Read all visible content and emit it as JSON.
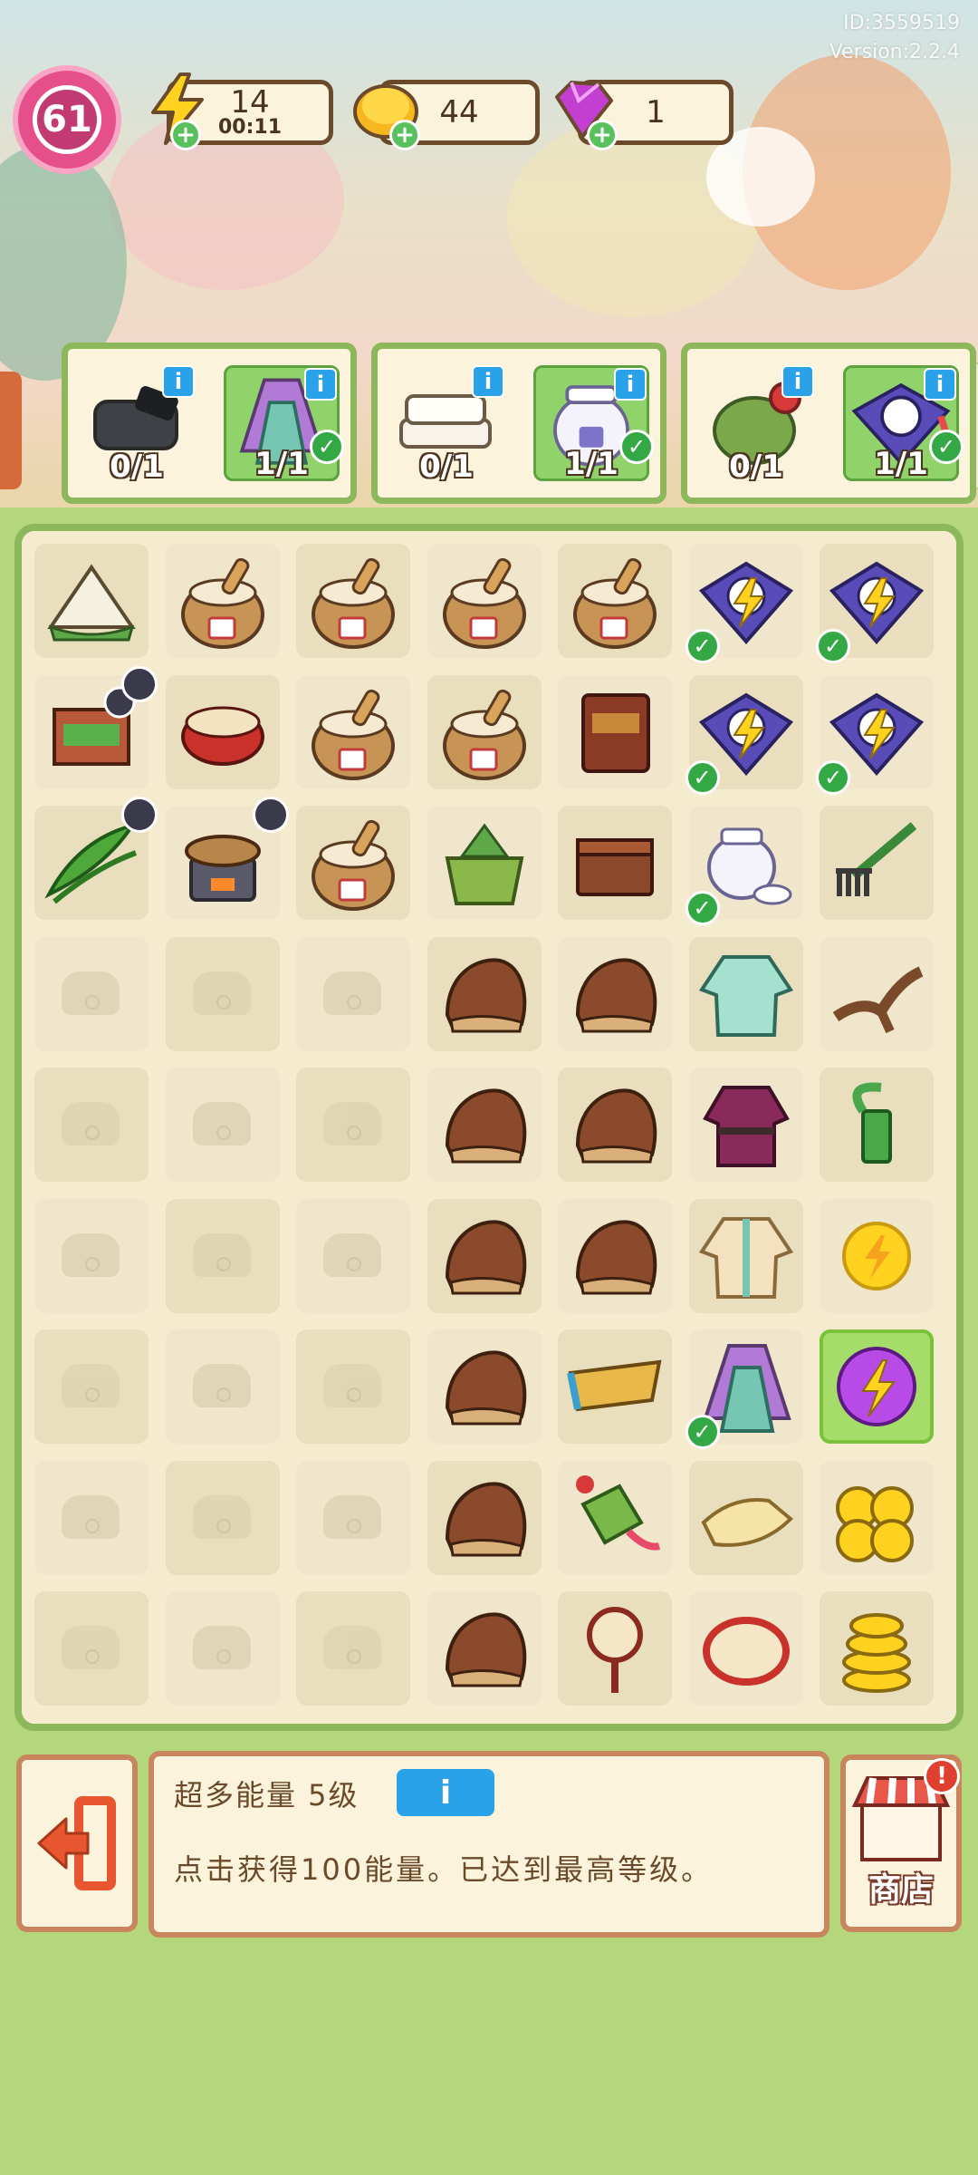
{
  "meta": {
    "id_text": "ID:3559519",
    "version_text": "Version:2.2.4"
  },
  "player": {
    "level": "61"
  },
  "resources": {
    "energy": {
      "value": "14",
      "timer": "00:11"
    },
    "coins": {
      "value": "44"
    },
    "gems": {
      "value": "1"
    }
  },
  "orders": [
    {
      "items": [
        {
          "name": "ink-stone",
          "count": "0/1",
          "done": false
        },
        {
          "name": "hanfu-dress",
          "count": "1/1",
          "done": true
        }
      ]
    },
    {
      "items": [
        {
          "name": "folded-cloth",
          "count": "0/1",
          "done": false
        },
        {
          "name": "cream-jar",
          "count": "1/1",
          "done": true
        }
      ]
    },
    {
      "items": [
        {
          "name": "pouch",
          "count": "0/1",
          "done": false
        },
        {
          "name": "bird-kite",
          "count": "1/1",
          "done": true
        }
      ]
    }
  ],
  "board": {
    "rows": [
      [
        "zongzi-duck",
        "rice-sack",
        "rice-sack",
        "rice-sack",
        "rice-sack",
        "bird-kite-energy",
        "bird-kite-energy"
      ],
      [
        "market-stall",
        "drum",
        "rice-sack",
        "rice-sack",
        "cabinet",
        "bird-kite-energy",
        "bird-kite-energy"
      ],
      [
        "bamboo-leaves",
        "stove",
        "rice-sack",
        "zongzi-basket",
        "box",
        "cream-jar",
        "rake"
      ],
      [
        "locked",
        "locked",
        "locked",
        "chestnut",
        "chestnut",
        "green-robe",
        "twig"
      ],
      [
        "locked",
        "locked",
        "locked",
        "chestnut",
        "chestnut",
        "purple-robe",
        "pump"
      ],
      [
        "locked",
        "locked",
        "locked",
        "chestnut",
        "chestnut",
        "beige-robe",
        "energy-coin"
      ],
      [
        "locked",
        "locked",
        "locked",
        "chestnut",
        "boat-tray",
        "hanfu-dress",
        "energy-orb"
      ],
      [
        "locked",
        "locked",
        "locked",
        "chestnut",
        "kite-bag",
        "silk-cloth",
        "coin-pile"
      ],
      [
        "locked",
        "locked",
        "locked",
        "chestnut",
        "rattle-drum",
        "tambourine",
        "coin-stack"
      ]
    ],
    "checked": [
      "0-5",
      "0-6",
      "1-5",
      "1-6",
      "2-5",
      "6-5"
    ]
  },
  "panel": {
    "title": "超多能量 5级",
    "info_label": "i",
    "description": "点击获得100能量。已达到最高等级。",
    "shop_label": "商店",
    "shop_alert": "!"
  },
  "colors": {
    "accent_green": "#8cb75a",
    "panel_border": "#c9855e",
    "info_blue": "#2aa2ea"
  }
}
